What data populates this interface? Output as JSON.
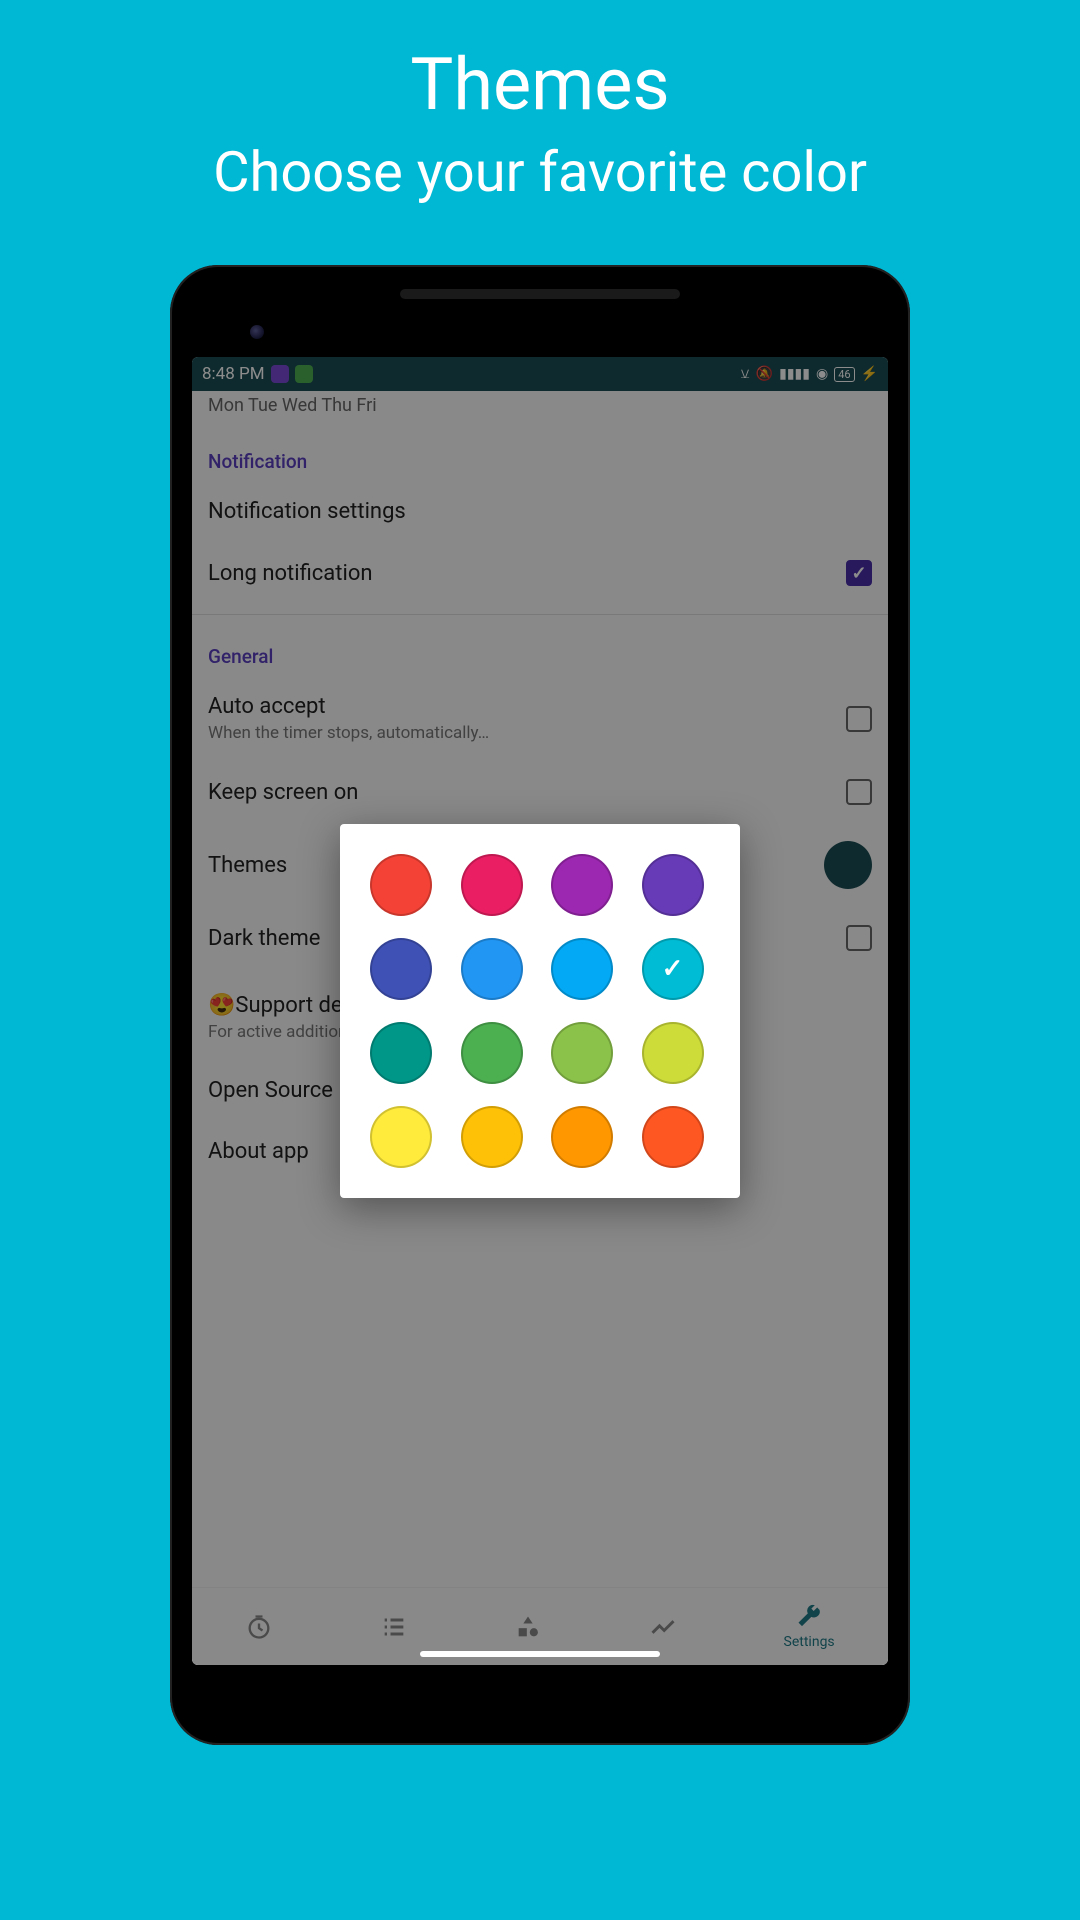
{
  "promo": {
    "title": "Themes",
    "subtitle": "Choose your favorite color"
  },
  "statusbar": {
    "time": "8:48 PM",
    "battery": "46"
  },
  "settings": {
    "weekdays": "Mon Tue Wed Thu Fri",
    "sec_notification": "Notification",
    "notif_settings": "Notification settings",
    "long_notif": "Long notification",
    "sec_general": "General",
    "auto_accept": {
      "title": "Auto accept",
      "sub": "When the timer stops, automatically…"
    },
    "keep_screen": "Keep screen on",
    "themes": "Themes",
    "dark_theme": "Dark theme",
    "support": {
      "title": "😍Support developers😍",
      "sub": "For active additional function buy some candies for developer :)"
    },
    "open_source": "Open Source Licenses",
    "about": "About app"
  },
  "nav": {
    "settings": "Settings"
  },
  "colors": [
    {
      "hex": "#f44336",
      "name": "red"
    },
    {
      "hex": "#e91e63",
      "name": "pink"
    },
    {
      "hex": "#9c27b0",
      "name": "purple"
    },
    {
      "hex": "#673ab7",
      "name": "deep-purple"
    },
    {
      "hex": "#3f51b5",
      "name": "indigo"
    },
    {
      "hex": "#2196f3",
      "name": "blue"
    },
    {
      "hex": "#03a9f4",
      "name": "light-blue"
    },
    {
      "hex": "#00bcd4",
      "name": "cyan",
      "selected": true
    },
    {
      "hex": "#009688",
      "name": "teal"
    },
    {
      "hex": "#4caf50",
      "name": "green"
    },
    {
      "hex": "#8bc34a",
      "name": "light-green"
    },
    {
      "hex": "#cddc39",
      "name": "lime"
    },
    {
      "hex": "#ffeb3b",
      "name": "yellow"
    },
    {
      "hex": "#ffc107",
      "name": "amber"
    },
    {
      "hex": "#ff9800",
      "name": "orange"
    },
    {
      "hex": "#ff5722",
      "name": "deep-orange"
    }
  ]
}
